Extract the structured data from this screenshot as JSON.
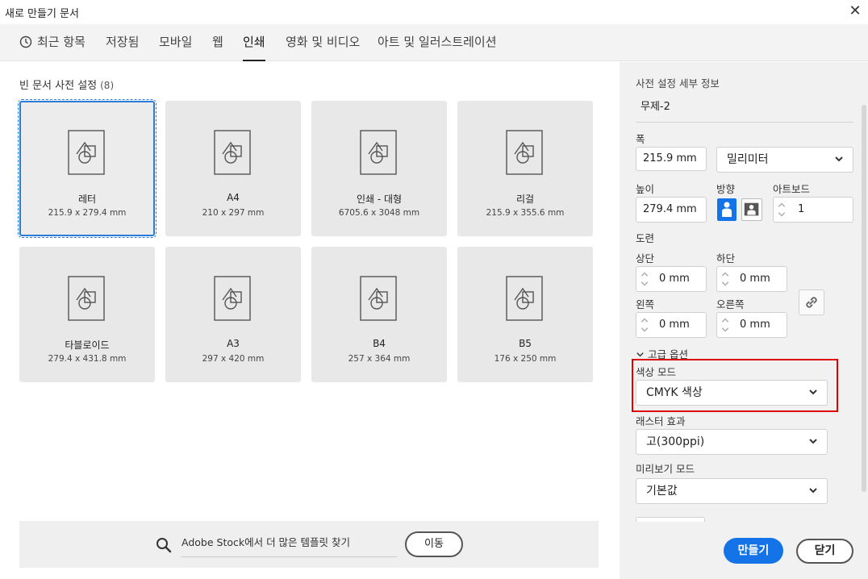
{
  "window": {
    "title": "새로 만들기 문서",
    "close_icon": "close-icon"
  },
  "tabs": [
    {
      "label": "최근 항목",
      "icon": "clock-icon",
      "active": false
    },
    {
      "label": "저장됨",
      "active": false
    },
    {
      "label": "모바일",
      "active": false
    },
    {
      "label": "웹",
      "active": false
    },
    {
      "label": "인쇄",
      "active": true
    },
    {
      "label": "영화 및 비디오",
      "active": false
    },
    {
      "label": "아트 및 일러스트레이션",
      "active": false
    }
  ],
  "presets": {
    "title": "빈 문서 사전 설정",
    "count": "(8)",
    "items": [
      {
        "name": "레터",
        "dims": "215.9 x 279.4 mm",
        "selected": true
      },
      {
        "name": "A4",
        "dims": "210 x 297 mm"
      },
      {
        "name": "인쇄 - 대형",
        "dims": "6705.6 x 3048 mm"
      },
      {
        "name": "리걸",
        "dims": "215.9 x 355.6 mm"
      },
      {
        "name": "타블로이드",
        "dims": "279.4 x 431.8 mm"
      },
      {
        "name": "A3",
        "dims": "297 x 420 mm"
      },
      {
        "name": "B4",
        "dims": "257 x 364 mm"
      },
      {
        "name": "B5",
        "dims": "176 x 250 mm"
      }
    ]
  },
  "search": {
    "icon": "search-icon",
    "text": "Adobe Stock에서 더 많은 템플릿 찾기",
    "go_label": "이동"
  },
  "details": {
    "title": "사전 설정 세부 정보",
    "doc_name": "무제-2",
    "width_label": "폭",
    "width_value": "215.9 mm",
    "unit_value": "밀리미터",
    "height_label": "높이",
    "height_value": "279.4 mm",
    "orientation_label": "방향",
    "orientation": "portrait",
    "artboards_label": "아트보드",
    "artboards_value": "1",
    "bleed_label": "도련",
    "top_label": "상단",
    "top_value": "0 mm",
    "bottom_label": "하단",
    "bottom_value": "0 mm",
    "left_label": "왼쪽",
    "left_value": "0 mm",
    "right_label": "오른쪽",
    "right_value": "0 mm",
    "link_icon": "link-icon",
    "advanced_label": "고급 옵션",
    "color_mode_label": "색상 모드",
    "color_mode_value": "CMYK 색상",
    "raster_label": "래스터 효과",
    "raster_value": "고(300ppi)",
    "preview_label": "미리보기 모드",
    "preview_value": "기본값"
  },
  "footer": {
    "create_label": "만들기",
    "close_label": "닫기"
  },
  "colors": {
    "accent": "#1473e6",
    "highlight": "#e00000"
  }
}
